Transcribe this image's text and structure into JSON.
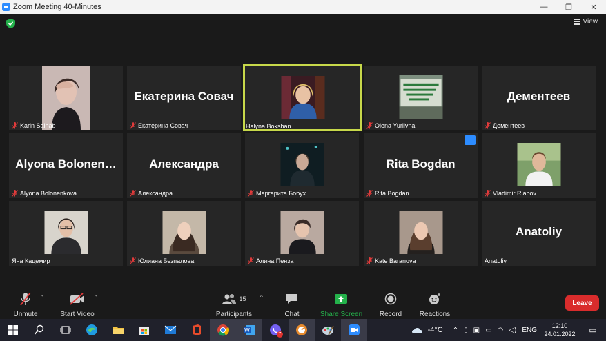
{
  "window": {
    "title": "Zoom Meeting 40-Minutes",
    "minimize": "—",
    "restore": "❐",
    "close": "✕"
  },
  "topbar": {
    "view_label": "View"
  },
  "participants": [
    {
      "name": "Karin Salhab",
      "muted": true
    },
    {
      "name": "Екатерина Совач",
      "display": "Екатерина Совач",
      "muted": true
    },
    {
      "name": "Halyna Bokshan",
      "muted": false,
      "active": true
    },
    {
      "name": "Olena Yuriivna",
      "muted": true
    },
    {
      "name": "Дементеев",
      "display": "Дементеев",
      "muted": true
    },
    {
      "name": "Alyona Bolonenkova",
      "display": "Alyona  Bolonen…",
      "muted": true
    },
    {
      "name": "Александра",
      "display": "Александра",
      "muted": true
    },
    {
      "name": "Маргарита Бобух",
      "muted": true
    },
    {
      "name": "Rita Bogdan",
      "display": "Rita Bogdan",
      "muted": true,
      "more": "···"
    },
    {
      "name": "Vladimir Riabov",
      "muted": true
    },
    {
      "name": "Яна Кацемир",
      "muted": false
    },
    {
      "name": "Юлиана Безпалова",
      "muted": true
    },
    {
      "name": "Алина Пенза",
      "muted": true
    },
    {
      "name": "Kate Baranova",
      "muted": true
    },
    {
      "name": "Anatoliy",
      "display": "Anatoliy",
      "muted": false
    }
  ],
  "toolbar": {
    "unmute": "Unmute",
    "start_video": "Start Video",
    "participants": "Participants",
    "participants_count": "15",
    "chat": "Chat",
    "share_screen": "Share Screen",
    "record": "Record",
    "reactions": "Reactions",
    "leave": "Leave",
    "caret": "^"
  },
  "taskbar": {
    "viber_badge": "7",
    "weather": "-4°C",
    "language": "ENG",
    "time": "12:10",
    "date": "24.01.2022"
  },
  "colors": {
    "active_border": "#c7d84a",
    "leave": "#d92c2c",
    "share": "#24b24b",
    "zoom_blue": "#2d8cff"
  }
}
